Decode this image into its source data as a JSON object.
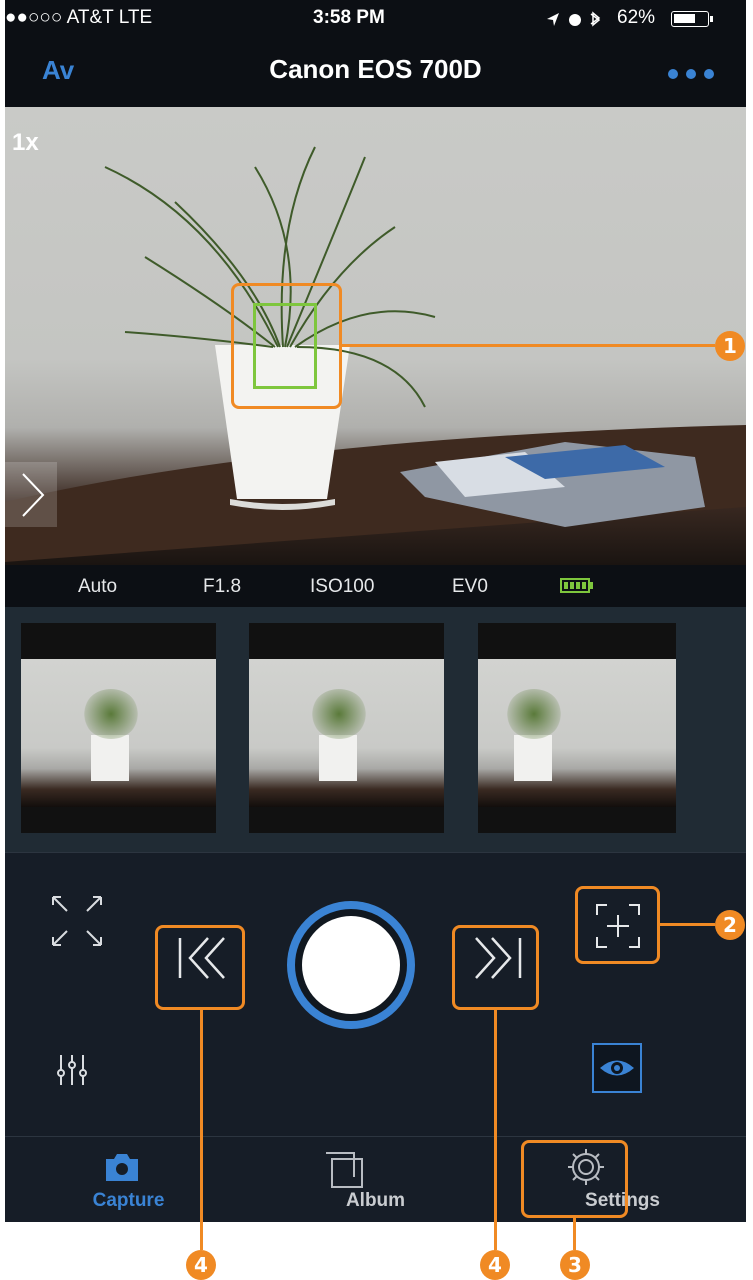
{
  "status_bar": {
    "carrier": "●●○○○ AT&T  LTE",
    "time": "3:58 PM",
    "battery_percent": "62%",
    "battery_level": 0.62
  },
  "nav": {
    "mode": "Av",
    "title": "Canon EOS 700D",
    "more_icon": "more-horizontal-icon"
  },
  "live_view": {
    "zoom": "1x"
  },
  "exposure": {
    "mode": "Auto",
    "aperture": "F1.8",
    "iso": "ISO100",
    "ev": "EV0",
    "battery_icon": "camera-battery-full-icon"
  },
  "thumbnails": [
    {
      "name": "photo-1"
    },
    {
      "name": "photo-2"
    },
    {
      "name": "photo-3"
    }
  ],
  "tabs": [
    {
      "label": "Capture",
      "icon": "camera-icon",
      "active": true
    },
    {
      "label": "Album",
      "icon": "album-icon",
      "active": false
    },
    {
      "label": "Settings",
      "icon": "gear-icon",
      "active": false
    }
  ],
  "callouts": [
    "1",
    "2",
    "3",
    "4",
    "4"
  ],
  "colors": {
    "accent": "#3a83d4",
    "annotation": "#f08a24",
    "focus_box": "#7ec63d",
    "background": "#161d27"
  }
}
